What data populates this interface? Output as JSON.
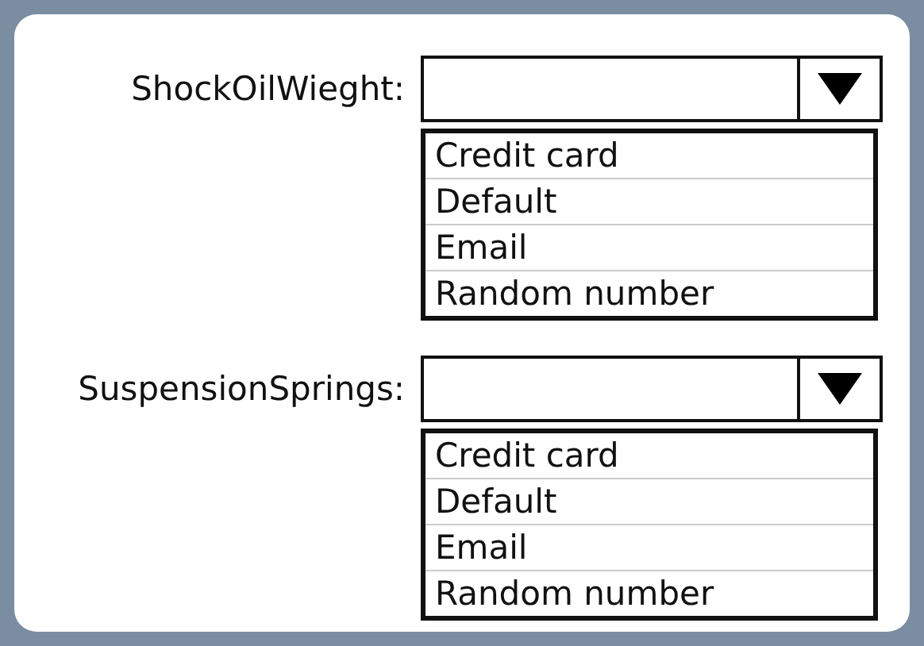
{
  "dropdowns": [
    {
      "label": "ShockOilWieght:",
      "options": [
        "Credit card",
        "Default",
        "Email",
        "Random number"
      ]
    },
    {
      "label": "SuspensionSprings:",
      "options": [
        "Credit card",
        "Default",
        "Email",
        "Random number"
      ]
    }
  ]
}
